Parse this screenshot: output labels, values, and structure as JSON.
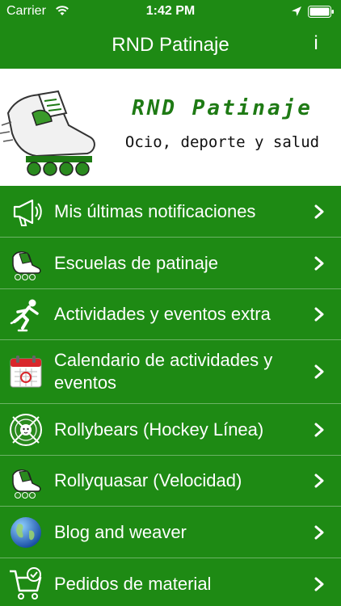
{
  "status_bar": {
    "carrier": "Carrier",
    "time": "1:42 PM",
    "icons": [
      "wifi-icon",
      "location-icon",
      "battery-icon"
    ]
  },
  "nav_bar": {
    "title": "RND Patinaje",
    "info_label": "i"
  },
  "banner": {
    "brand": "RND Patinaje",
    "tagline": "Ocio, deporte y salud",
    "logo_icon": "skate-logo-icon"
  },
  "menu": {
    "items": [
      {
        "label": "Mis últimas notificaciones",
        "icon": "megaphone-icon"
      },
      {
        "label": "Escuelas de patinaje",
        "icon": "skate-icon"
      },
      {
        "label": "Actividades y eventos extra",
        "icon": "skater-icon"
      },
      {
        "label": "Calendario de actividades y eventos",
        "icon": "calendar-icon"
      },
      {
        "label": "Rollybears (Hockey Línea)",
        "icon": "hockey-badge-icon"
      },
      {
        "label": "Rollyquasar (Velocidad)",
        "icon": "skate-icon"
      },
      {
        "label": "Blog and weaver",
        "icon": "globe-icon"
      },
      {
        "label": "Pedidos de material",
        "icon": "cart-icon"
      }
    ]
  },
  "colors": {
    "background": "#1e8a14",
    "banner": "#ffffff",
    "brand_text": "#1e7a14"
  }
}
